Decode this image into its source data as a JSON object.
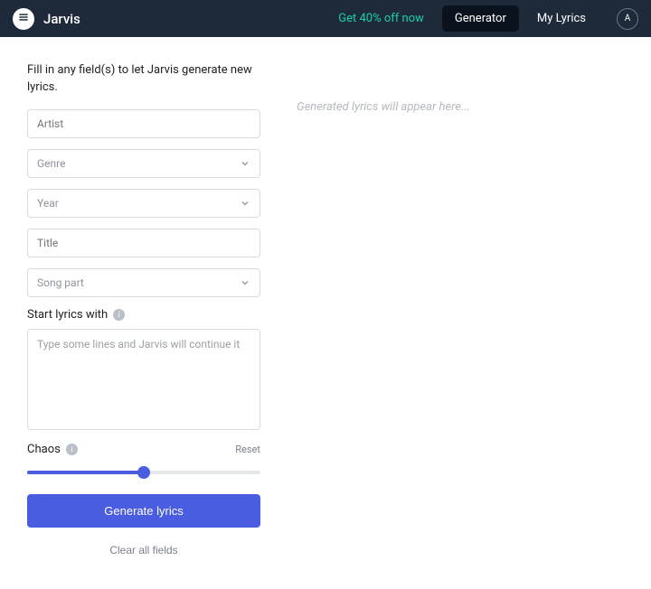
{
  "header": {
    "brand": "Jarvis",
    "promo": "Get 40% off now",
    "nav": {
      "generator": "Generator",
      "my_lyrics": "My Lyrics"
    },
    "avatar_initial": "A"
  },
  "form": {
    "instructions": "Fill in any field(s) to let Jarvis generate new lyrics.",
    "artist_placeholder": "Artist",
    "genre_placeholder": "Genre",
    "year_placeholder": "Year",
    "title_placeholder": "Title",
    "songpart_placeholder": "Song part",
    "start_label": "Start lyrics with",
    "start_placeholder": "Type some lines and Jarvis will continue it",
    "chaos_label": "Chaos",
    "reset_label": "Reset",
    "chaos_percent": 50,
    "generate_label": "Generate lyrics",
    "clear_label": "Clear all fields"
  },
  "output": {
    "placeholder": "Generated lyrics will appear here..."
  }
}
